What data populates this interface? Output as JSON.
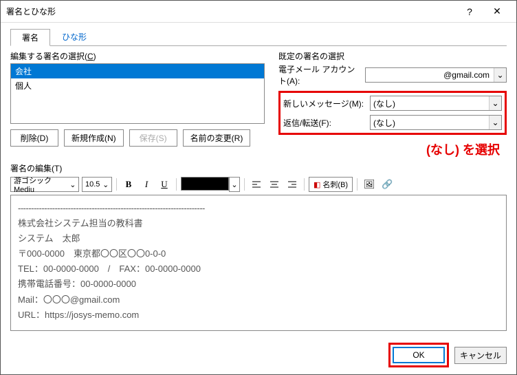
{
  "titlebar": {
    "title": "署名とひな形"
  },
  "tabs": {
    "signature": "署名",
    "stationery": "ひな形"
  },
  "left": {
    "select_label_pre": "編集する署名の選択(",
    "select_label_key": "C",
    "select_label_post": ")",
    "items": [
      "会社",
      "個人"
    ],
    "buttons": {
      "delete": "削除(D)",
      "new": "新規作成(N)",
      "save": "保存(S)",
      "rename": "名前の変更(R)"
    }
  },
  "right": {
    "group_label": "既定の署名の選択",
    "account_label": "電子メール アカウント(A):",
    "account_value": "@gmail.com",
    "new_msg_label": "新しいメッセージ(M):",
    "new_msg_value": "(なし)",
    "reply_label": "返信/転送(F):",
    "reply_value": "(なし)"
  },
  "annotation": "(なし) を選択",
  "edit_label": "署名の編集(T)",
  "toolbar": {
    "font": "游ゴシック Mediu",
    "size": "10.5",
    "card": "名刺(B)"
  },
  "signature_body": {
    "dashes": "-----------------------------------------------------------------------",
    "line1": "株式会社システム担当の教科書",
    "line2": "システム　太郎",
    "line3": "〒000-0000　東京都〇〇区〇〇0-0-0",
    "line4": "TEL：00-0000-0000　/　FAX：00-0000-0000",
    "line5": "携帯電話番号：00-0000-0000",
    "line6": "Mail：〇〇〇@gmail.com",
    "line7": "URL：https://josys-memo.com"
  },
  "footer": {
    "ok": "OK",
    "cancel": "キャンセル"
  }
}
